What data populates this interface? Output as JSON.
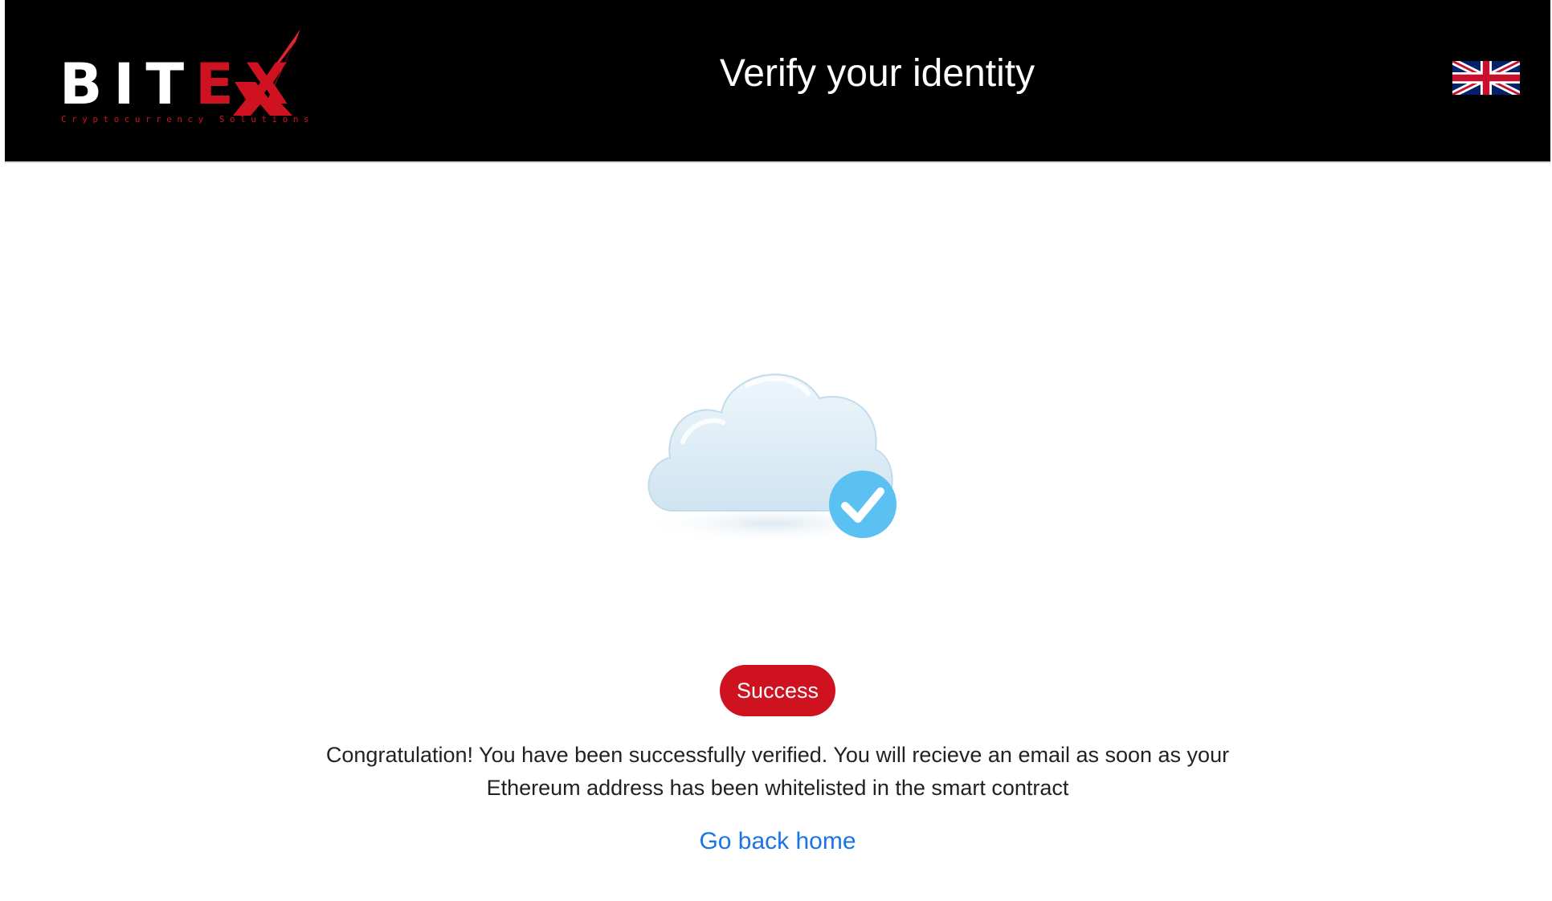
{
  "header": {
    "logo": {
      "word_white": "BIT",
      "word_red": "EX",
      "tagline": "Cryptocurrency Solutions"
    },
    "title": "Verify your identity",
    "language_icon": "uk-flag-icon"
  },
  "main": {
    "illustration_icon": "cloud-check-icon",
    "status_badge": "Success",
    "message": "Congratulation! You have been successfully verified. You will recieve an email as soon as your Ethereum address has been whitelisted in the smart contract",
    "home_link": "Go back home"
  },
  "colors": {
    "header_bg": "#000000",
    "brand_red": "#cf1220",
    "link_blue": "#1a73e8",
    "check_blue": "#5bc0f2"
  }
}
